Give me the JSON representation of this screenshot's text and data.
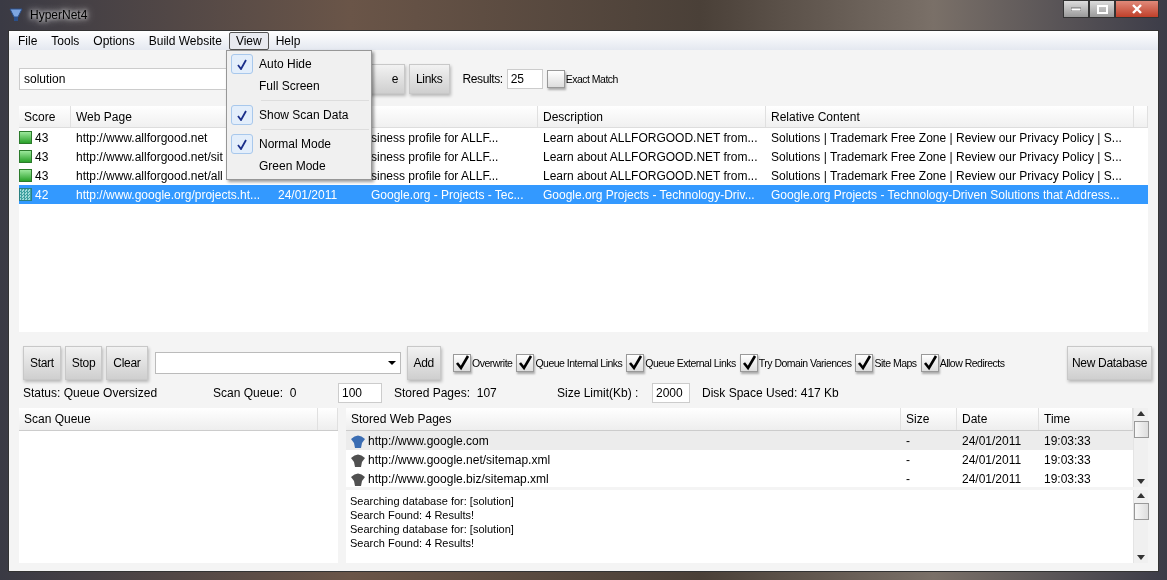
{
  "window": {
    "title": "HyperNet4"
  },
  "menu_bar": [
    {
      "label": "File",
      "selected": false
    },
    {
      "label": "Tools",
      "selected": false
    },
    {
      "label": "Options",
      "selected": false
    },
    {
      "label": "Build Website",
      "selected": false
    },
    {
      "label": "View",
      "selected": true
    },
    {
      "label": "Help",
      "selected": false
    }
  ],
  "view_menu": [
    {
      "kind": "item",
      "label": "Auto Hide",
      "checked": true
    },
    {
      "kind": "item",
      "label": "Full Screen",
      "checked": false
    },
    {
      "kind": "separator"
    },
    {
      "kind": "item",
      "label": "Show Scan Data",
      "checked": true
    },
    {
      "kind": "separator"
    },
    {
      "kind": "item",
      "label": "Normal Mode",
      "checked": true
    },
    {
      "kind": "item",
      "label": "Green Mode",
      "checked": false
    }
  ],
  "search": {
    "value": "solution",
    "partial_button": "e",
    "links_button": "Links",
    "results_label": "Results:",
    "results_value": "25",
    "exact_match": {
      "label": "Exact Match",
      "checked": false
    }
  },
  "results_table": {
    "columns": [
      "Score",
      "Web Page",
      "Description",
      "Relative Content"
    ],
    "rows": [
      {
        "score": "43",
        "web_page": "http://www.allforgood.net",
        "title": "siness profile for ALLF...",
        "description": "Learn about ALLFORGOOD.NET from...",
        "relative_content": "Solutions | Trademark Free Zone | Review our Privacy Policy | S...",
        "selected": false
      },
      {
        "score": "43",
        "web_page": "http://www.allforgood.net/sit",
        "title": "siness profile for ALLF...",
        "description": "Learn about ALLFORGOOD.NET from...",
        "relative_content": "Solutions | Trademark Free Zone | Review our Privacy Policy | S...",
        "selected": false
      },
      {
        "score": "43",
        "web_page": "http://www.allforgood.net/all",
        "title": "siness profile for ALLF...",
        "description": "Learn about ALLFORGOOD.NET from...",
        "relative_content": "Solutions | Trademark Free Zone | Review our Privacy Policy | S...",
        "selected": false
      },
      {
        "score": "42",
        "web_page": "http://www.google.org/projects.ht...",
        "date": "24/01/2011",
        "title": "Google.org - Projects - Tec...",
        "description": "Google.org Projects - Technology-Driv...",
        "relative_content": "Google.org Projects - Technology-Driven Solutions that Address...",
        "selected": true
      }
    ]
  },
  "toolbar": {
    "buttons": [
      "Start",
      "Stop",
      "Clear"
    ],
    "add_button": "Add",
    "new_database_button": "New Database",
    "options": [
      {
        "label": "Overwrite",
        "checked": true
      },
      {
        "label": "Queue Internal Links",
        "checked": true
      },
      {
        "label": "Queue External Links",
        "checked": true
      },
      {
        "label": "Try Domain Variences",
        "checked": true
      },
      {
        "label": "Site Maps",
        "checked": true
      },
      {
        "label": "Allow Redirects",
        "checked": true
      }
    ]
  },
  "status": {
    "status": "Status: Queue Oversized",
    "scan_queue": "Scan Queue:  0",
    "queue_limit": "100",
    "stored_pages": "Stored Pages:  107",
    "size_limit_label": "Size Limit(Kb) :",
    "size_limit": "2000",
    "disk_space": "Disk Space Used: 417 Kb"
  },
  "scan_queue": {
    "title": "Scan Queue"
  },
  "stored_pages": {
    "columns": [
      "Stored Web Pages",
      "Size",
      "Date",
      "Time"
    ],
    "rows": [
      {
        "url": "http://www.google.com",
        "size": "-",
        "date": "24/01/2011",
        "time": "19:03:33",
        "color": "#3b6db3",
        "selected": true
      },
      {
        "url": "http://www.google.net/sitemap.xml",
        "size": "-",
        "date": "24/01/2011",
        "time": "19:03:33",
        "color": "#505050",
        "selected": false
      },
      {
        "url": "http://www.google.biz/sitemap.xml",
        "size": "-",
        "date": "24/01/2011",
        "time": "19:03:33",
        "color": "#505050",
        "selected": false
      }
    ]
  },
  "log": [
    "Searching database for: [solution]",
    "Search Found: 4 Results!",
    "Searching database for: [solution]",
    "Search Found: 4 Results!"
  ]
}
